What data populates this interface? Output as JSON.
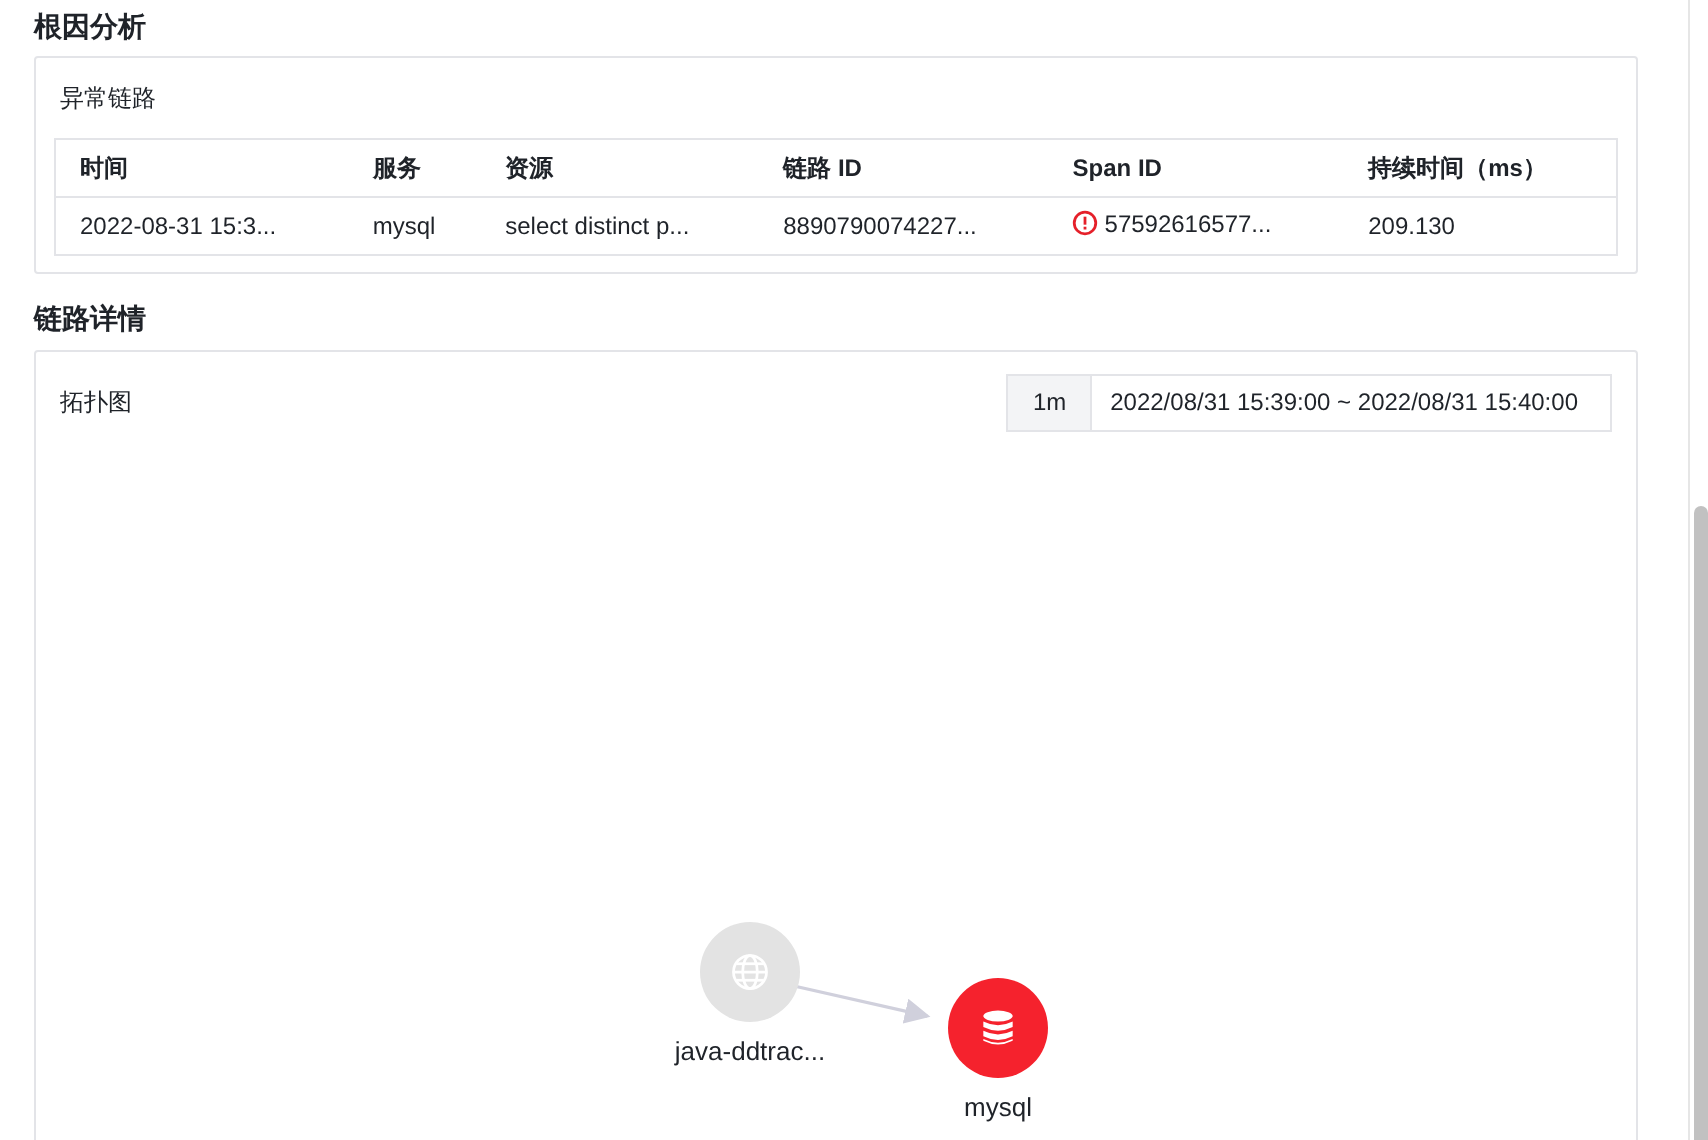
{
  "root_cause": {
    "title": "根因分析",
    "card_title": "异常链路",
    "table": {
      "columns": [
        "时间",
        "服务",
        "资源",
        "链路 ID",
        "Span ID",
        "持续时间（ms）"
      ],
      "rows": [
        {
          "cells": [
            "2022-08-31 15:3...",
            "mysql",
            "select distinct p...",
            "8890790074227...",
            "57592616577...",
            "209.130"
          ],
          "error": true
        }
      ]
    }
  },
  "trace_detail": {
    "title": "链路详情",
    "card_title": "拓扑图",
    "time_range": {
      "interval": "1m",
      "range": "2022/08/31 15:39:00 ~ 2022/08/31 15:40:00"
    },
    "nodes": [
      {
        "kind": "service",
        "label": "java-ddtrac...",
        "error": false
      },
      {
        "kind": "database",
        "label": "mysql",
        "error": true
      }
    ]
  }
}
